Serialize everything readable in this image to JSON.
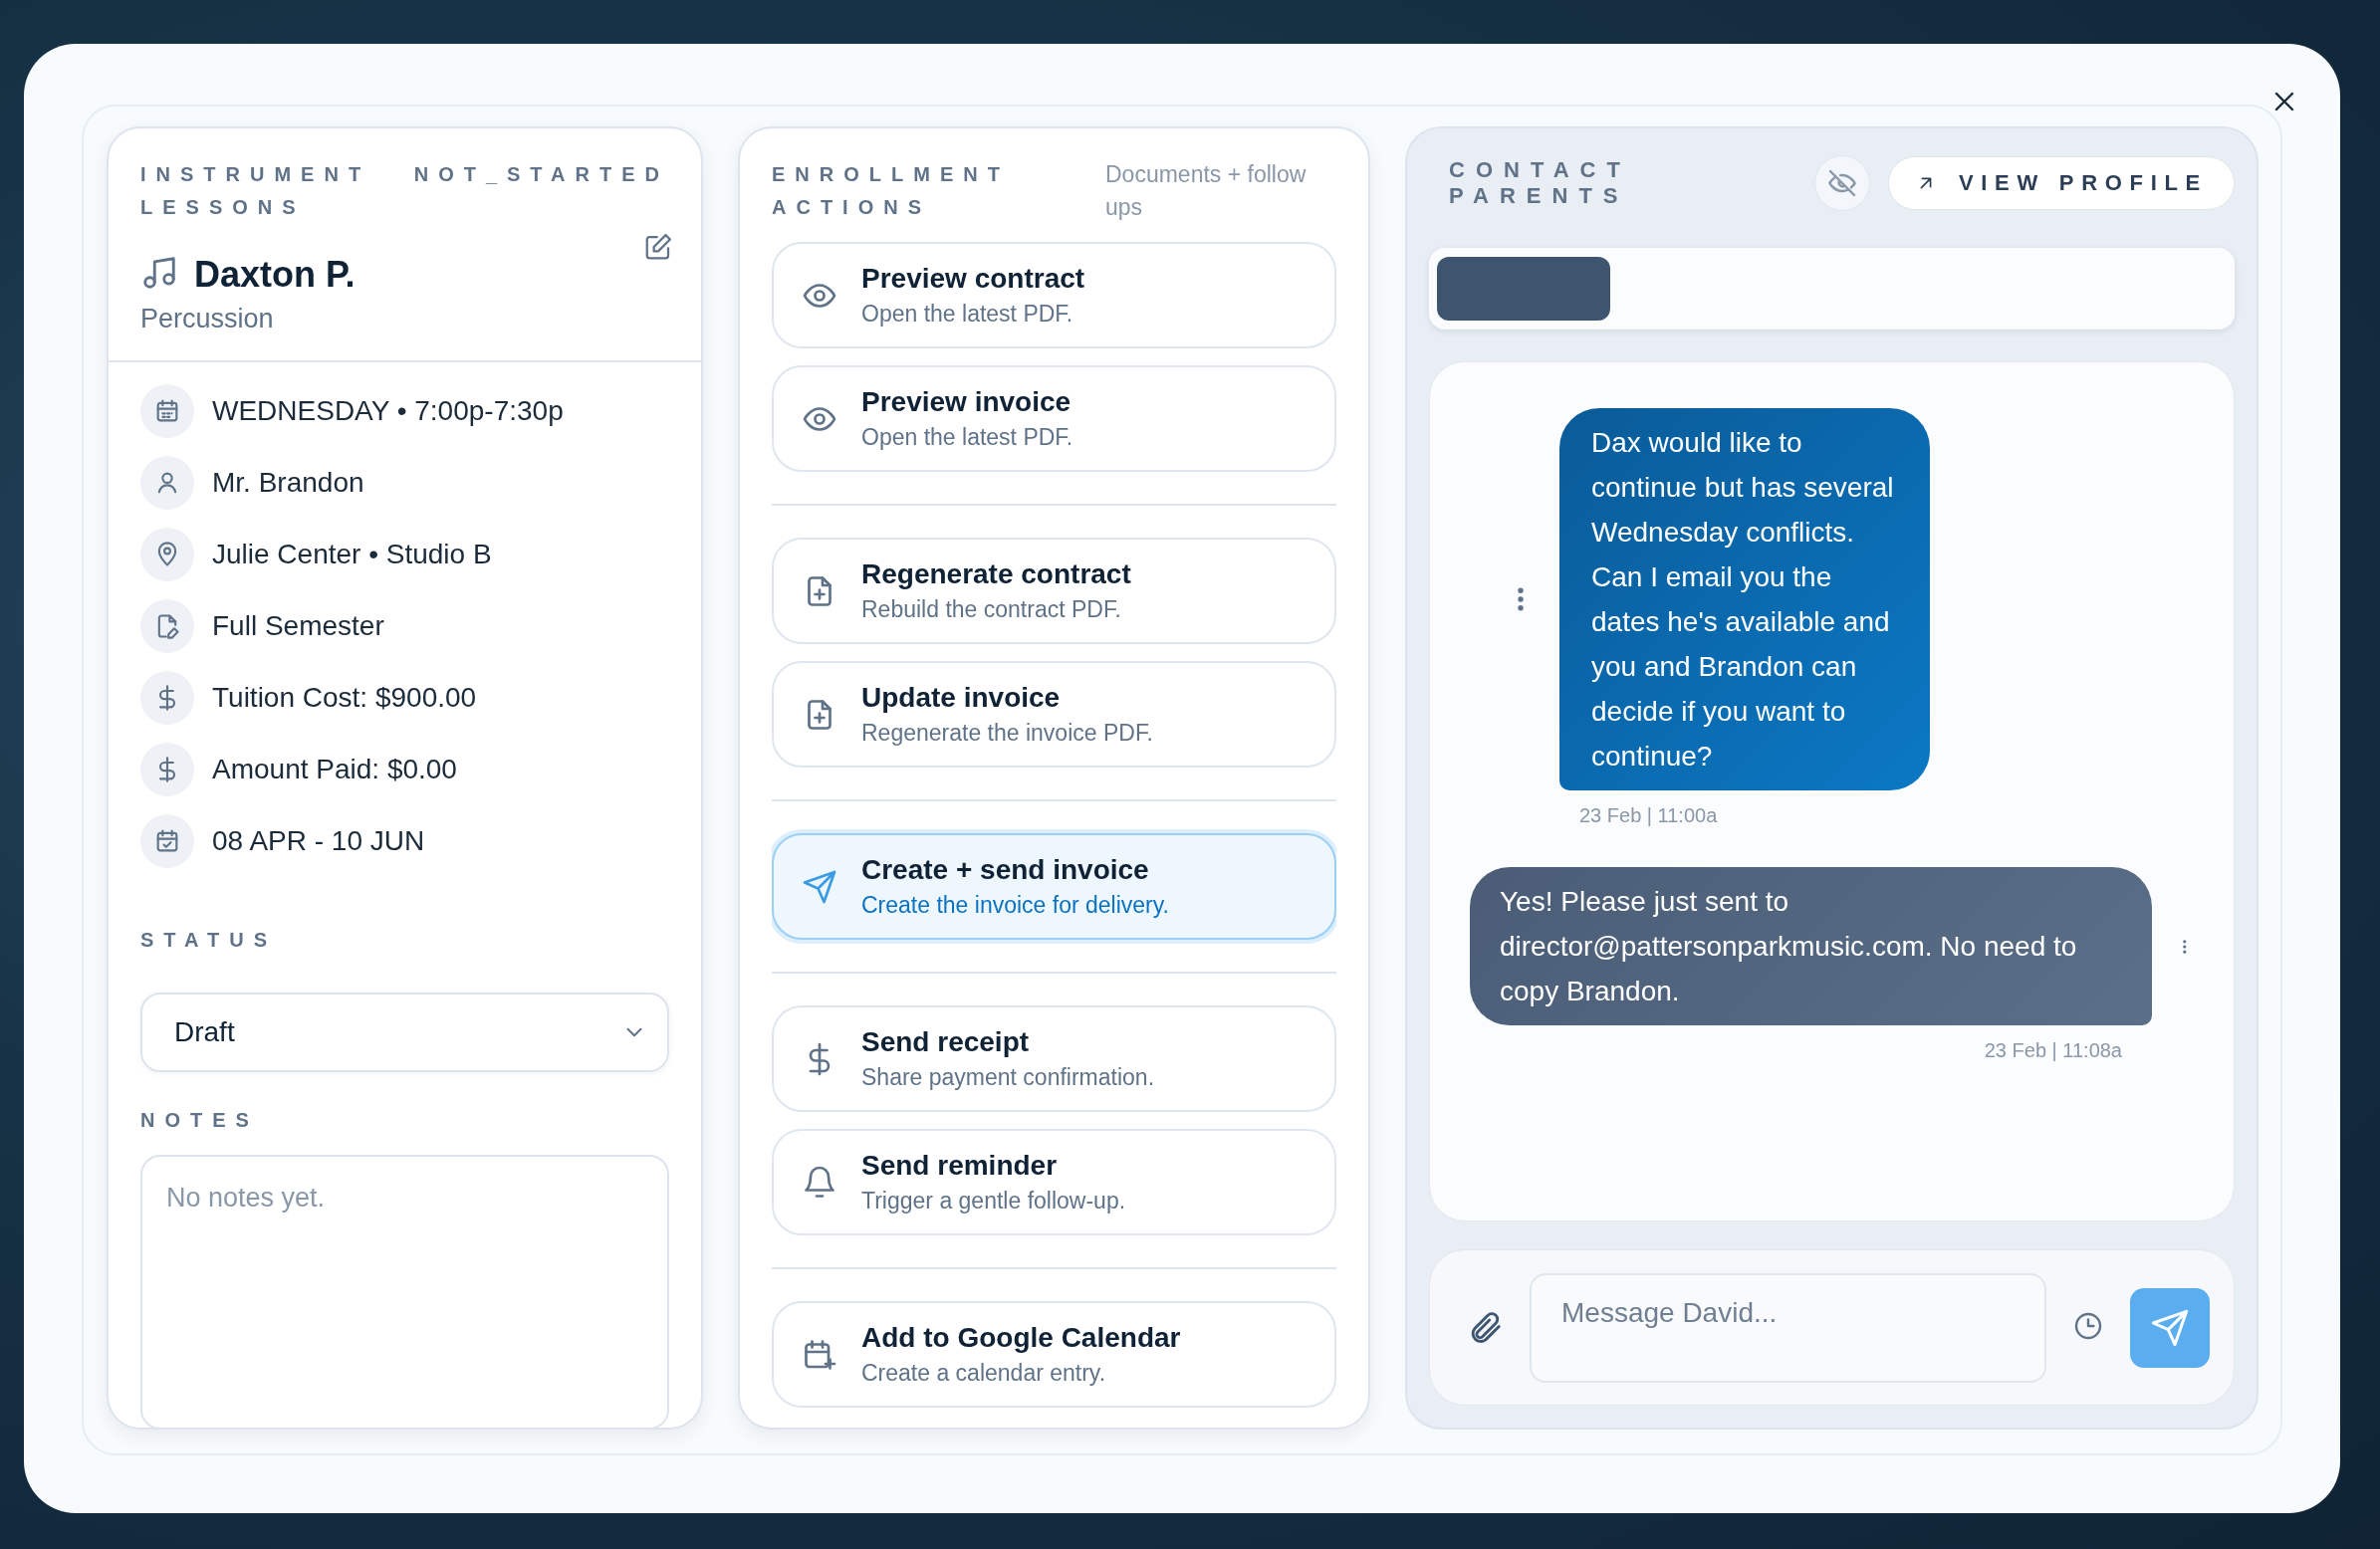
{
  "lesson": {
    "category": "INSTRUMENT LESSONS",
    "status_code": "NOT_STARTED",
    "student": "Daxton P.",
    "instrument": "Percussion",
    "details": [
      {
        "kind": "schedule",
        "text": "WEDNESDAY • 7:00p-7:30p"
      },
      {
        "kind": "teacher",
        "text": "Mr. Brandon"
      },
      {
        "kind": "location",
        "text": "Julie Center • Studio B"
      },
      {
        "kind": "term",
        "text": "Full Semester"
      },
      {
        "kind": "money",
        "text": "Tuition Cost: $900.00"
      },
      {
        "kind": "money",
        "text": "Amount Paid: $0.00"
      },
      {
        "kind": "dates",
        "text": "08 APR - 10 JUN"
      }
    ],
    "status_label": "STATUS",
    "status_value": "Draft",
    "notes_label": "NOTES",
    "notes_placeholder": "No notes yet."
  },
  "actions": {
    "title": "ENROLLMENT ACTIONS",
    "subtitle": "Documents + follow ups",
    "groups": [
      {
        "items": [
          {
            "kind": "preview",
            "title": "Preview contract",
            "subtitle": "Open the latest PDF.",
            "highlighted": false
          },
          {
            "kind": "preview",
            "title": "Preview invoice",
            "subtitle": "Open the latest PDF.",
            "highlighted": false
          }
        ]
      },
      {
        "items": [
          {
            "kind": "document",
            "title": "Regenerate contract",
            "subtitle": "Rebuild the contract PDF.",
            "highlighted": false
          },
          {
            "kind": "document",
            "title": "Update invoice",
            "subtitle": "Regenerate the invoice PDF.",
            "highlighted": false
          }
        ]
      },
      {
        "items": [
          {
            "kind": "send",
            "title": "Create + send invoice",
            "subtitle": "Create the invoice for delivery.",
            "highlighted": true
          }
        ]
      },
      {
        "items": [
          {
            "kind": "payment",
            "title": "Send receipt",
            "subtitle": "Share payment confirmation.",
            "highlighted": false
          },
          {
            "kind": "reminder",
            "title": "Send reminder",
            "subtitle": "Trigger a gentle follow-up.",
            "highlighted": false
          }
        ]
      },
      {
        "items": [
          {
            "kind": "calendar",
            "title": "Add to Google Calendar",
            "subtitle": "Create a calendar entry.",
            "highlighted": false
          }
        ]
      }
    ]
  },
  "contact": {
    "title": "CONTACT PARENTS",
    "view_profile": "VIEW PROFILE",
    "messages": [
      {
        "kind": "incoming",
        "text": "Dax would like to continue but has several Wednesday conflicts. Can I email you the dates he's available and you and Brandon can decide if you want to continue?",
        "time": "23 Feb | 11:00a"
      },
      {
        "kind": "outgoing",
        "text": "Yes! Please just sent to director@pattersonparkmusic.com. No need to copy Brandon.",
        "time": "23 Feb | 11:08a"
      }
    ],
    "composer_placeholder": "Message David..."
  }
}
